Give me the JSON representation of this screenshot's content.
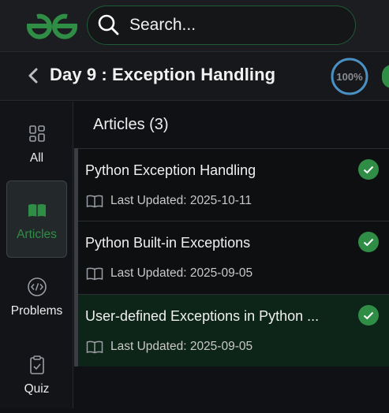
{
  "header": {
    "search_placeholder": "Search..."
  },
  "titlebar": {
    "title": "Day 9 : Exception Handling",
    "progress_text": "100%"
  },
  "rail": {
    "items": [
      {
        "label": "All",
        "icon": "grid-icon"
      },
      {
        "label": "Articles",
        "icon": "open-book-icon"
      },
      {
        "label": "Problems",
        "icon": "code-icon"
      },
      {
        "label": "Quiz",
        "icon": "clipboard-check-icon"
      }
    ]
  },
  "main": {
    "heading": "Articles (3)",
    "articles": [
      {
        "title": "Python Exception Handling",
        "meta": "Last Updated: 2025-10-11"
      },
      {
        "title": "Python Built-in Exceptions",
        "meta": "Last Updated: 2025-09-05"
      },
      {
        "title": "User-defined Exceptions in Python ...",
        "meta": "Last Updated: 2025-09-05"
      }
    ]
  },
  "colors": {
    "brand_green": "#2f8d46",
    "progress_ring": "#4a90c2",
    "highlight_bg": "#0d2519"
  }
}
